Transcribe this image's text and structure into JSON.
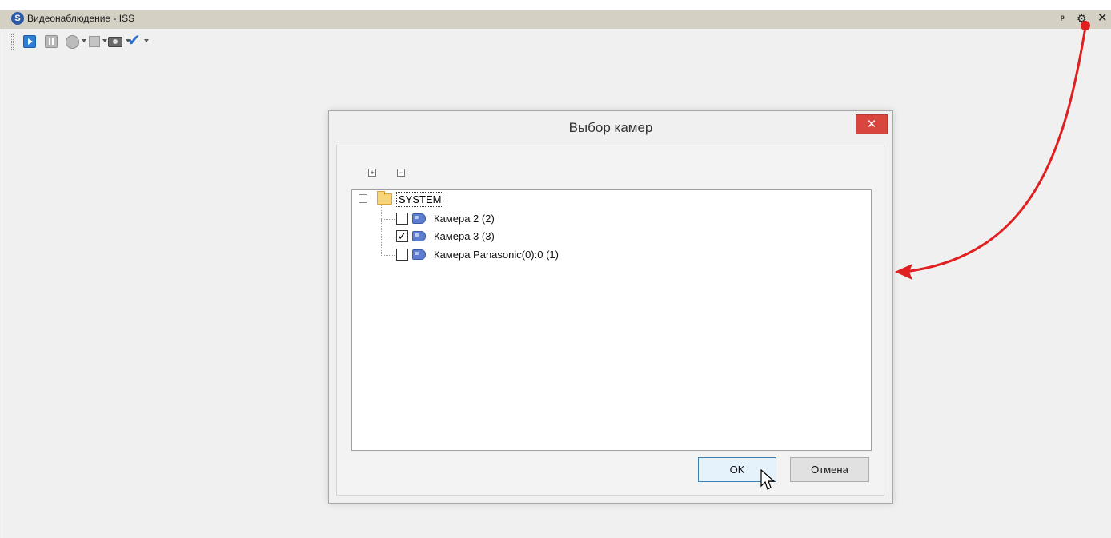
{
  "window": {
    "title": "Видеонаблюдение - ISS",
    "logo_glyph": "S",
    "controls": {
      "pin": "ᵖ",
      "gear": "⚙",
      "close": "✕"
    }
  },
  "toolbar": {
    "icons": [
      "play-icon",
      "pause-icon",
      "record-icon",
      "stop-icon",
      "snapshot-icon",
      "check-icon"
    ]
  },
  "dialog": {
    "title": "Выбор камер",
    "close_glyph": "✕",
    "expand_all": "+",
    "collapse_all": "−",
    "tree": {
      "root": {
        "label": "SYSTEM",
        "toggle": "−"
      },
      "cameras": [
        {
          "label": "Камера 2 (2)",
          "checked": false
        },
        {
          "label": "Камера 3 (3)",
          "checked": true
        },
        {
          "label": "Камера Panasonic(0):0 (1)",
          "checked": false
        }
      ]
    },
    "ok_label": "OK",
    "cancel_label": "Отмена"
  },
  "colors": {
    "annotation_arrow": "#e02020",
    "dialog_close": "#d9463d",
    "ok_border": "#3c7fb1"
  }
}
